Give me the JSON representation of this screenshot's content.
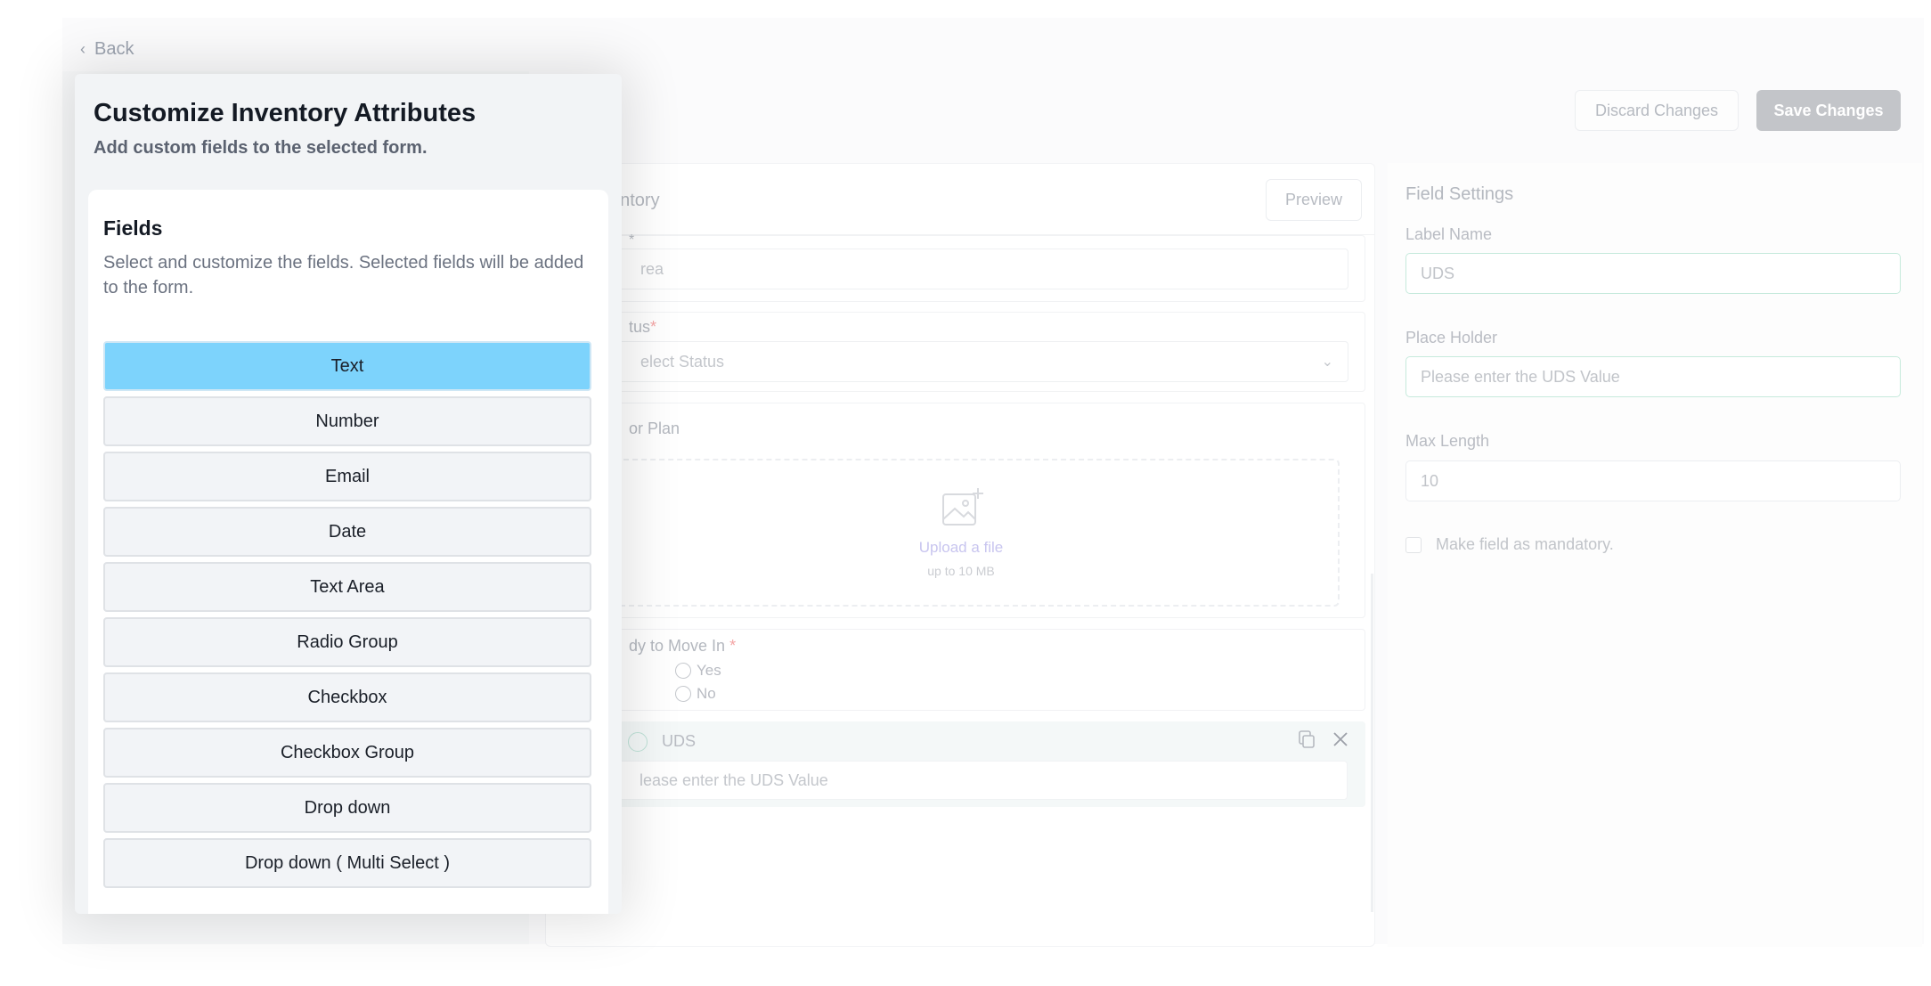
{
  "back": {
    "label": "Back"
  },
  "header": {
    "discard_label": "Discard Changes",
    "save_label": "Save Changes"
  },
  "form": {
    "title": "entory",
    "preview_label": "Preview",
    "fields": {
      "area_label": "*",
      "area_placeholder": "rea",
      "status_label": "tus",
      "status_required": "*",
      "status_placeholder": "elect Status",
      "floor_plan_label": "or Plan",
      "upload_link": "Upload a file",
      "upload_hint": "up to  10 MB",
      "ready_label": "dy to Move In",
      "ready_required": "*",
      "ready_options": [
        "Yes",
        "No"
      ],
      "uds_label": "UDS",
      "uds_placeholder": "lease enter the UDS   Value"
    }
  },
  "settings": {
    "title": "Field Settings",
    "label_name_label": "Label Name",
    "label_name_value": "UDS",
    "placeholder_label": "Place Holder",
    "placeholder_value": "Please enter the UDS   Value",
    "max_length_label": "Max Length",
    "max_length_value": "10",
    "mandatory_label": "Make field as mandatory."
  },
  "drawer": {
    "title": "Customize Inventory Attributes",
    "subtitle": "Add custom fields to the selected form.",
    "fields_heading": "Fields",
    "fields_description": "Select and customize the fields. Selected fields will be added to the form.",
    "field_types": [
      "Text",
      "Number",
      "Email",
      "Date",
      "Text Area",
      "Radio Group",
      "Checkbox",
      "Checkbox Group",
      "Drop down",
      "Drop down ( Multi Select )"
    ],
    "selected_field_type": "Text"
  },
  "colors": {
    "selected_field": "#7dd3fc",
    "save_button": "#c3c5c9",
    "required_asterisk": "#f4a5a5",
    "upload_link": "#c8c5ef"
  }
}
